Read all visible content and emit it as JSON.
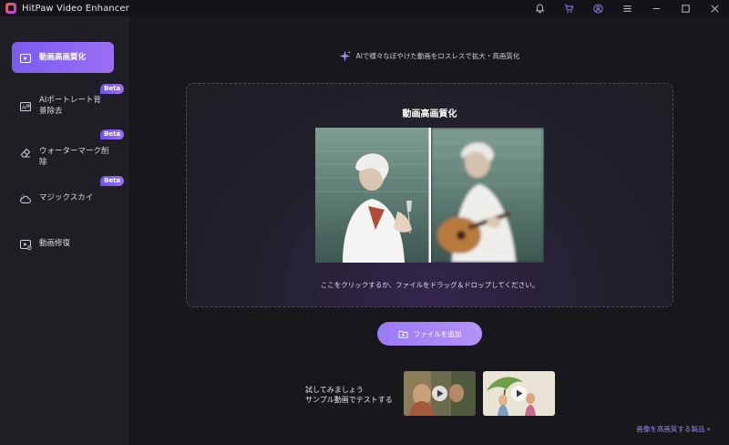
{
  "titlebar": {
    "title": "HitPaw Video Enhancer",
    "icons": [
      "bell-icon",
      "cart-icon",
      "account-icon",
      "menu-icon",
      "minimize-icon",
      "maximize-icon",
      "close-icon"
    ]
  },
  "sidebar": {
    "items": [
      {
        "label": "動画高画質化",
        "icon": "video-enhance-icon",
        "active": true,
        "beta": ""
      },
      {
        "label": "AIポートレート背景除去",
        "icon": "ai-portrait-icon",
        "active": false,
        "beta": "Beta"
      },
      {
        "label": "ウォーターマーク削除",
        "icon": "eraser-icon",
        "active": false,
        "beta": "Beta"
      },
      {
        "label": "マジックスカイ",
        "icon": "sky-cloud-icon",
        "active": false,
        "beta": "Beta"
      },
      {
        "label": "動画修復",
        "icon": "video-repair-icon",
        "active": false,
        "beta": ""
      }
    ]
  },
  "main": {
    "tagline": "AIで様々なぼやけた動画をロスレスで拡大・高画質化",
    "dropzone": {
      "title": "動画高画質化",
      "hint": "ここをクリックするか、ファイルをドラッグ＆ドロップしてください。"
    },
    "add_button": "ファイルを追加",
    "sample": {
      "line1": "試してみましょう",
      "line2": "サンプル動画でテストする"
    },
    "bottom_link": "画像を高画質する製品",
    "bottom_link_arrow": "»"
  },
  "colors": {
    "accent": "#8a67f2",
    "sidebar_bg": "#1e1e24",
    "main_bg": "#17171c",
    "link": "#9a86f5"
  }
}
